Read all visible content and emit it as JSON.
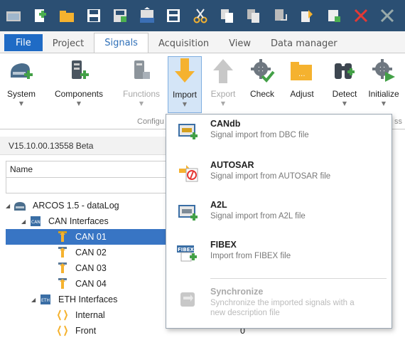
{
  "quick_access": {
    "icons": [
      "open-folder-icon",
      "new-file-icon",
      "open-icon",
      "save-icon",
      "save-as-icon",
      "auto-icon",
      "save-all-icon",
      "cut-icon",
      "copy-icon",
      "paste-icon",
      "undo-icon",
      "redo-icon",
      "delete-icon",
      "clear-icon",
      "refresh-icon"
    ]
  },
  "tabs": {
    "file": "File",
    "project": "Project",
    "signals": "Signals",
    "acquisition": "Acquisition",
    "view": "View",
    "data_manager": "Data manager"
  },
  "ribbon": {
    "system": "System",
    "components": "Components",
    "functions": "Functions",
    "import": "Import",
    "export": "Export",
    "check": "Check",
    "adjust": "Adjust",
    "detect": "Detect",
    "initialize": "Initialize",
    "group_config": "Configu",
    "group_acq": "ss"
  },
  "panel": {
    "version": "V15.10.00.13558 Beta",
    "name_header": "Name"
  },
  "tree": [
    {
      "label": "ARCOS 1.5 - dataLog",
      "icon": "device-icon",
      "level": 1
    },
    {
      "label": "CAN Interfaces",
      "icon": "can-interface-icon",
      "level": 2
    },
    {
      "label": "CAN 01",
      "icon": "can-port-icon",
      "level": 3,
      "selected": true
    },
    {
      "label": "CAN 02",
      "icon": "can-port-icon",
      "level": 3
    },
    {
      "label": "CAN 03",
      "icon": "can-port-icon",
      "level": 3
    },
    {
      "label": "CAN 04",
      "icon": "can-port-icon",
      "level": 3
    },
    {
      "label": "ETH Interfaces",
      "icon": "eth-interface-icon",
      "level": 2
    },
    {
      "label": "Internal",
      "icon": "eth-port-icon",
      "level": 3
    },
    {
      "label": "Front",
      "icon": "eth-port-icon",
      "level": 3,
      "value": "0"
    }
  ],
  "import_menu": [
    {
      "title": "CANdb",
      "desc": "Signal import from DBC file"
    },
    {
      "title": "AUTOSAR",
      "desc": "Signal import from AUTOSAR file"
    },
    {
      "title": "A2L",
      "desc": "Signal import from A2L file"
    },
    {
      "title": "FIBEX",
      "desc": "Import from FIBEX file"
    },
    {
      "title": "Synchronize",
      "desc": "Synchronize the imported signals with a new description file"
    }
  ],
  "colors": {
    "accent": "#1f6bc5",
    "selection": "#3875c4",
    "toolbar_bg": "#2b4f73"
  }
}
